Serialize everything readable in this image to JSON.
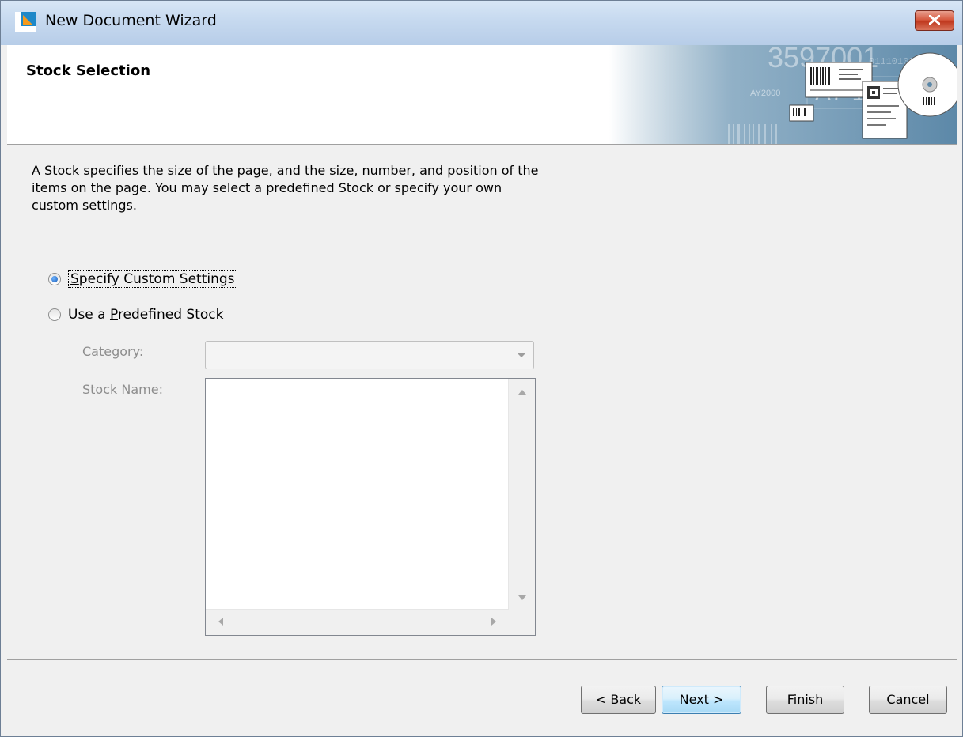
{
  "window": {
    "title": "New Document Wizard",
    "close_label": "Close"
  },
  "header": {
    "title": "Stock Selection",
    "banner_text_1": "3597001",
    "banner_text_2": "A7-118",
    "banner_text_3": "AY2000",
    "banner_binary": "01110100010101"
  },
  "content": {
    "description": "A Stock specifies the size of the page, and the size, number, and position of the items on the page. You may select a predefined Stock or specify your own custom settings.",
    "options": [
      {
        "pre": "",
        "mnemonic": "S",
        "post": "pecify Custom Settings",
        "checked": true
      },
      {
        "pre": "Use a ",
        "mnemonic": "P",
        "post": "redefined Stock",
        "checked": false
      }
    ],
    "category_label": {
      "pre": "",
      "mnemonic": "C",
      "post": "ategory:"
    },
    "category_value": "",
    "stock_name_label": {
      "pre": "Stoc",
      "mnemonic": "k",
      "post": " Name:"
    },
    "stock_items": []
  },
  "buttons": {
    "back": {
      "pre": "< ",
      "mnemonic": "B",
      "post": "ack"
    },
    "next": {
      "pre": "",
      "mnemonic": "N",
      "post": "ext >"
    },
    "finish": {
      "pre": "",
      "mnemonic": "F",
      "post": "inish"
    },
    "cancel": {
      "pre": "Cancel",
      "mnemonic": "",
      "post": ""
    }
  }
}
